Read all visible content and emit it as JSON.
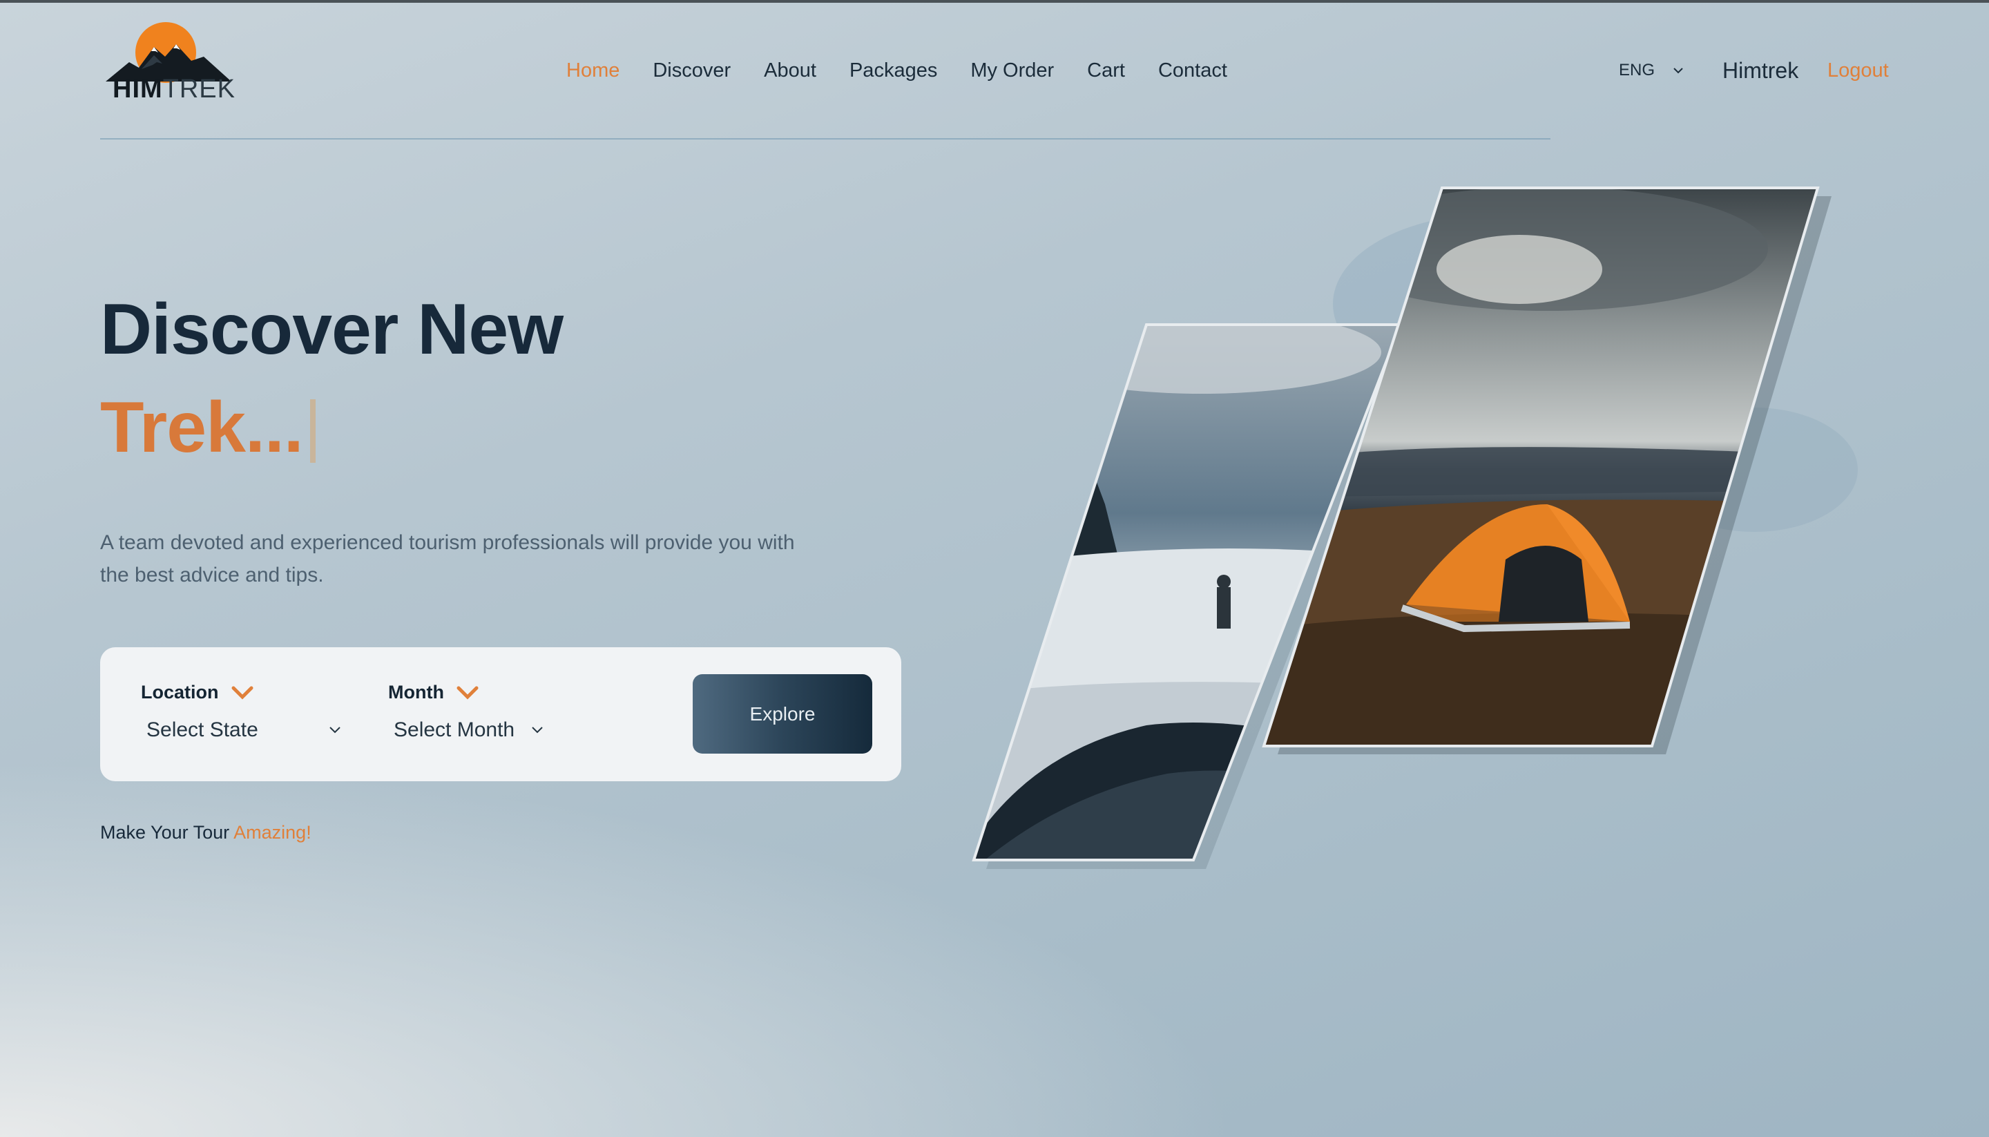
{
  "brand": {
    "name_part1": "HIM",
    "name_part2": "TREK",
    "accent_color": "#e0803a",
    "dark_color": "#17293a"
  },
  "nav": {
    "items": [
      {
        "label": "Home",
        "active": true
      },
      {
        "label": "Discover",
        "active": false
      },
      {
        "label": "About",
        "active": false
      },
      {
        "label": "Packages",
        "active": false
      },
      {
        "label": "My Order",
        "active": false
      },
      {
        "label": "Cart",
        "active": false
      },
      {
        "label": "Contact",
        "active": false
      }
    ]
  },
  "header": {
    "language": "ENG",
    "user_name": "Himtrek",
    "logout_label": "Logout"
  },
  "hero": {
    "title": "Discover New",
    "subtitle": "Trek...",
    "description": "A team devoted and experienced tourism professionals will provide you with the best advice and tips."
  },
  "search": {
    "location_label": "Location",
    "location_value": "Select State",
    "month_label": "Month",
    "month_value": "Select Month",
    "explore_label": "Explore"
  },
  "tagline": {
    "text": "Make Your Tour ",
    "accent": "Amazing!"
  },
  "icons": {
    "label_chevron": "chevron-down-icon",
    "select_chevron": "chevron-down-icon",
    "logo": "mountain-sun-logo"
  }
}
